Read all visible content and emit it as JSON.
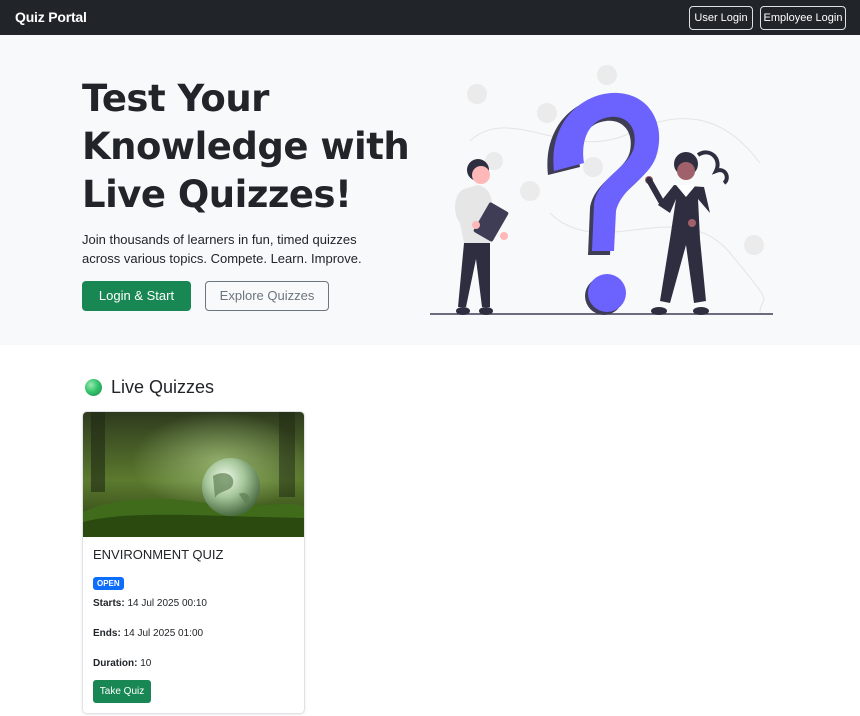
{
  "navbar": {
    "brand": "Quiz Portal",
    "user_login": "User Login",
    "employee_login": "Employee Login"
  },
  "hero": {
    "title": "Test Your Knowledge with Live Quizzes!",
    "subtitle": "Join thousands of learners in fun, timed quizzes across various topics. Compete. Learn. Improve.",
    "primary_button": "Login & Start",
    "secondary_button": "Explore Quizzes"
  },
  "live_quizzes": {
    "heading": "Live Quizzes",
    "items": [
      {
        "title": "ENVIRONMENT QUIZ",
        "status": "OPEN",
        "starts_label": "Starts:",
        "starts": "14 Jul 2025 00:10",
        "ends_label": "Ends:",
        "ends": "14 Jul 2025 01:00",
        "duration_label": "Duration:",
        "duration": "10",
        "button": "Take Quiz"
      }
    ]
  },
  "colors": {
    "navbar_bg": "#212529",
    "hero_bg": "#f8f9fa",
    "success": "#198754",
    "primary": "#0d6efd",
    "accent_purple": "#6c63ff"
  }
}
